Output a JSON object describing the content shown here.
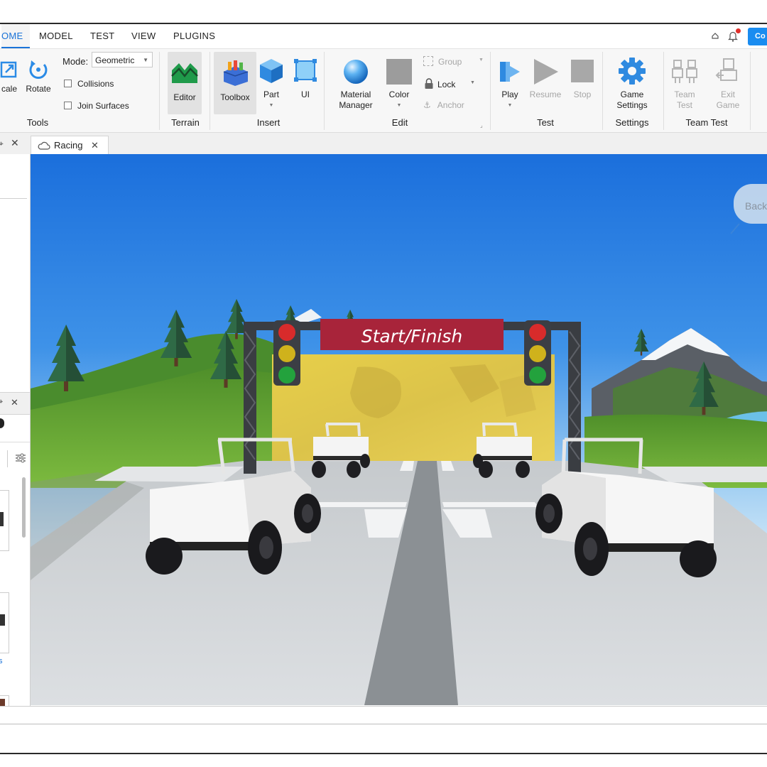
{
  "menu": {
    "tabs": [
      {
        "label": "OME",
        "active": true
      },
      {
        "label": "MODEL",
        "active": false
      },
      {
        "label": "TEST",
        "active": false
      },
      {
        "label": "VIEW",
        "active": false
      },
      {
        "label": "PLUGINS",
        "active": false
      }
    ],
    "collaborate_label": "Co"
  },
  "ribbon": {
    "tools": {
      "scale_label": "cale",
      "rotate_label": "Rotate",
      "mode_label": "Mode:",
      "mode_value": "Geometric",
      "collisions_label": "Collisions",
      "join_surfaces_label": "Join Surfaces",
      "group_label": "Tools"
    },
    "terrain": {
      "editor_label": "Editor",
      "group_label": "Terrain"
    },
    "insert": {
      "toolbox_label": "Toolbox",
      "part_label": "Part",
      "ui_label": "UI",
      "group_label": "Insert"
    },
    "edit": {
      "material_label_1": "Material",
      "material_label_2": "Manager",
      "color_label": "Color",
      "group_btn_label": "Group",
      "lock_label": "Lock",
      "anchor_label": "Anchor",
      "group_label": "Edit"
    },
    "test": {
      "play_label": "Play",
      "resume_label": "Resume",
      "stop_label": "Stop",
      "group_label": "Test"
    },
    "settings": {
      "game_label_1": "Game",
      "game_label_2": "Settings",
      "group_label": "Settings"
    },
    "team_test": {
      "team_label_1": "Team",
      "team_label_2": "Test",
      "exit_label_1": "Exit",
      "exit_label_2": "Game",
      "group_label": "Team Test"
    }
  },
  "document_tab": {
    "title": "Racing"
  },
  "viewport": {
    "banner_text": "Start/Finish",
    "back_button_label": "Back"
  },
  "colors": {
    "accent_blue": "#1a8cf0",
    "banner_red": "#a8243a",
    "sky_top": "#1b6fdc",
    "sky_bottom": "#cfe6f8",
    "grass": "#5e9e35",
    "road": "#d2d6da"
  },
  "icons": {
    "scale": "scale-icon",
    "rotate": "rotate-icon",
    "terrain": "terrain-editor-icon",
    "toolbox": "toolbox-icon",
    "part": "part-cube-icon",
    "ui": "ui-frame-icon",
    "material": "material-sphere-icon",
    "color": "color-swatch-icon",
    "play": "play-icon",
    "resume": "resume-icon",
    "stop": "stop-icon",
    "settings": "gear-icon",
    "lock": "lock-icon",
    "anchor": "anchor-icon"
  }
}
